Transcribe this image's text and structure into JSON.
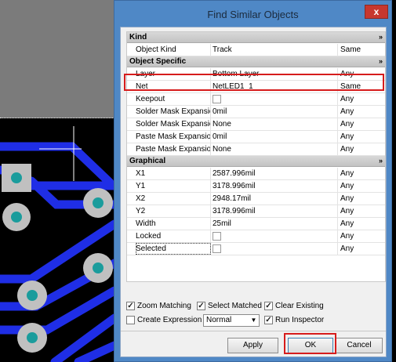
{
  "dialog": {
    "title": "Find Similar Objects",
    "close_label": "x"
  },
  "categories": {
    "kind": "Kind",
    "object_specific": "Object Specific",
    "graphical": "Graphical",
    "collapse_glyph": "»"
  },
  "rows": [
    {
      "name": "Object Kind",
      "value": "Track",
      "mode": "Same"
    },
    {
      "name": "Layer",
      "value": "Bottom Layer",
      "mode": "Any"
    },
    {
      "name": "Net",
      "value": "NetLED1_1",
      "mode": "Same"
    },
    {
      "name": "Keepout",
      "value": "",
      "mode": "Any",
      "checkbox": true
    },
    {
      "name": "Solder Mask Expansion",
      "value": "0mil",
      "mode": "Any"
    },
    {
      "name": "Solder Mask Expansion",
      "value": "None",
      "mode": "Any"
    },
    {
      "name": "Paste Mask Expansion",
      "value": "0mil",
      "mode": "Any"
    },
    {
      "name": "Paste Mask Expansion",
      "value": "None",
      "mode": "Any"
    },
    {
      "name": "X1",
      "value": "2587.996mil",
      "mode": "Any"
    },
    {
      "name": "Y1",
      "value": "3178.996mil",
      "mode": "Any"
    },
    {
      "name": "X2",
      "value": "2948.17mil",
      "mode": "Any"
    },
    {
      "name": "Y2",
      "value": "3178.996mil",
      "mode": "Any"
    },
    {
      "name": "Width",
      "value": "25mil",
      "mode": "Any"
    },
    {
      "name": "Locked",
      "value": "",
      "mode": "Any",
      "checkbox": true
    },
    {
      "name": "Selected",
      "value": "",
      "mode": "Any",
      "checkbox": true
    }
  ],
  "options": {
    "zoom_matching": {
      "label": "Zoom Matching",
      "checked": true
    },
    "select_matched": {
      "label": "Select Matched",
      "checked": true
    },
    "clear_existing": {
      "label": "Clear Existing",
      "checked": true
    },
    "create_expression": {
      "label": "Create Expression",
      "checked": false
    },
    "selection_mode": "Normal",
    "run_inspector": {
      "label": "Run Inspector",
      "checked": true
    },
    "check_glyph": "✓"
  },
  "buttons": {
    "apply": "Apply",
    "ok": "OK",
    "cancel": "Cancel"
  },
  "colors": {
    "dialog_frame": "#4f88c6",
    "highlight": "#d61c1c",
    "pcb_trace": "#1f2ee6",
    "pcb_pad": "#c0c0c0",
    "pcb_hole": "#1a9c9c"
  }
}
